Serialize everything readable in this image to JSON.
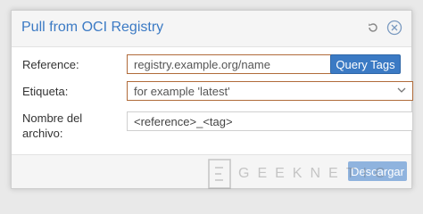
{
  "dialog": {
    "title": "Pull from OCI Registry",
    "icons": [
      "reset-icon",
      "close-icon"
    ]
  },
  "form": {
    "reference": {
      "label": "Reference:",
      "placeholder": "registry.example.org/name",
      "value": ""
    },
    "query_button": "Query Tags",
    "tag": {
      "label": "Etiqueta:",
      "placeholder": "for example 'latest'"
    },
    "filename": {
      "label_line1": "Nombre del",
      "label_line2": "archivo:",
      "value": "<reference>_<tag>"
    }
  },
  "footer": {
    "download_button": "Descargar"
  },
  "watermark": {
    "text": "GEEKNETIC"
  },
  "colors": {
    "accent": "#3b7ac4",
    "invalid_border": "#b06b3a",
    "disabled_button": "#8fb3de"
  }
}
